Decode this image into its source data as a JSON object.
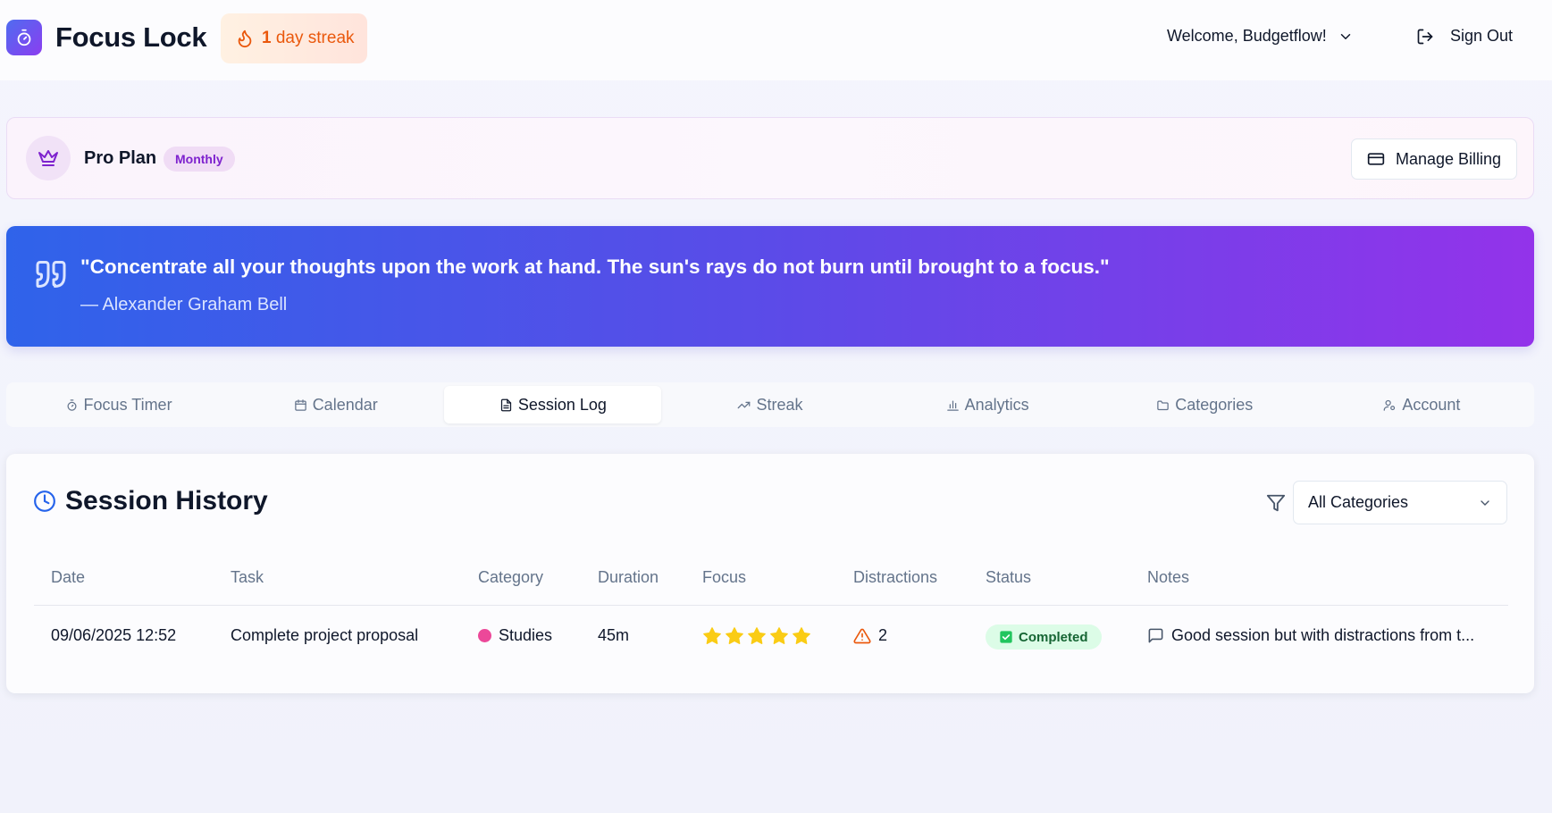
{
  "header": {
    "app_title": "Focus Lock",
    "streak_count": "1",
    "streak_label": "day streak",
    "welcome": "Welcome, Budgetflow!",
    "sign_out": "Sign Out"
  },
  "plan": {
    "name": "Pro Plan",
    "badge": "Monthly",
    "manage_billing": "Manage Billing"
  },
  "quote": {
    "text": "\"Concentrate all your thoughts upon the work at hand. The sun's rays do not burn until brought to a focus.\"",
    "author": "— Alexander Graham Bell"
  },
  "tabs": [
    {
      "label": "Focus Timer",
      "icon": "timer-icon"
    },
    {
      "label": "Calendar",
      "icon": "calendar-icon"
    },
    {
      "label": "Session Log",
      "icon": "file-text-icon",
      "active": true
    },
    {
      "label": "Streak",
      "icon": "trending-up-icon"
    },
    {
      "label": "Analytics",
      "icon": "bar-chart-icon"
    },
    {
      "label": "Categories",
      "icon": "folder-icon"
    },
    {
      "label": "Account",
      "icon": "user-icon"
    }
  ],
  "history": {
    "title": "Session History",
    "filter_value": "All Categories",
    "columns": [
      "Date",
      "Task",
      "Category",
      "Duration",
      "Focus",
      "Distractions",
      "Status",
      "Notes"
    ],
    "rows": [
      {
        "date": "09/06/2025 12:52",
        "task": "Complete project proposal",
        "category": "Studies",
        "category_color": "#ec4899",
        "duration": "45m",
        "focus_rating": 5,
        "distractions": "2",
        "status": "Completed",
        "notes": "Good session but with distractions from t..."
      }
    ]
  },
  "colors": {
    "brand_gradient_start": "#4f6cf0",
    "brand_gradient_end": "#8b3df0",
    "streak_orange": "#ea580c",
    "plan_purple": "#7e22ce",
    "star_yellow": "#facc15",
    "status_green": "#166534"
  }
}
